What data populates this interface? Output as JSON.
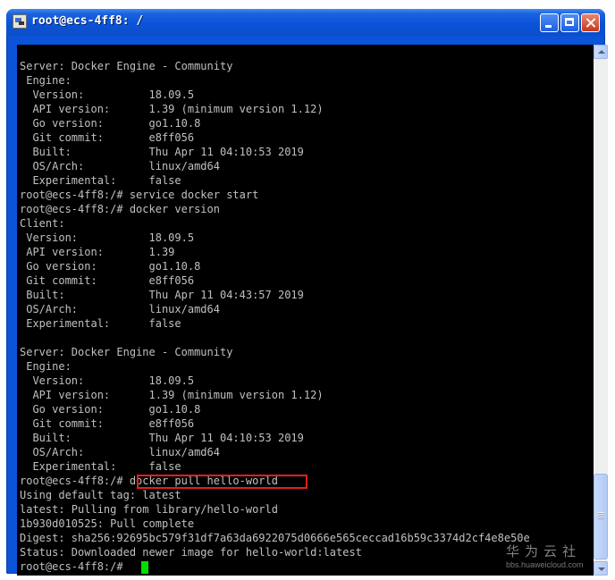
{
  "window": {
    "title": "root@ecs-4ff8: /"
  },
  "terminal": {
    "lines": [
      "",
      "Server: Docker Engine - Community",
      " Engine:",
      "  Version:          18.09.5",
      "  API version:      1.39 (minimum version 1.12)",
      "  Go version:       go1.10.8",
      "  Git commit:       e8ff056",
      "  Built:            Thu Apr 11 04:10:53 2019",
      "  OS/Arch:          linux/amd64",
      "  Experimental:     false",
      "root@ecs-4ff8:/# service docker start",
      "root@ecs-4ff8:/# docker version",
      "Client:",
      " Version:           18.09.5",
      " API version:       1.39",
      " Go version:        go1.10.8",
      " Git commit:        e8ff056",
      " Built:             Thu Apr 11 04:43:57 2019",
      " OS/Arch:           linux/amd64",
      " Experimental:      false",
      "",
      "Server: Docker Engine - Community",
      " Engine:",
      "  Version:          18.09.5",
      "  API version:      1.39 (minimum version 1.12)",
      "  Go version:       go1.10.8",
      "  Git commit:       e8ff056",
      "  Built:            Thu Apr 11 04:10:53 2019",
      "  OS/Arch:          linux/amd64",
      "  Experimental:     false",
      "root@ecs-4ff8:/# docker pull hello-world",
      "Using default tag: latest",
      "latest: Pulling from library/hello-world",
      "1b930d010525: Pull complete",
      "Digest: sha256:92695bc579f31df7a63da6922075d0666e565ceccad16b59c3374d2cf4e8e50e",
      "Status: Downloaded newer image for hello-world:latest",
      "root@ecs-4ff8:/# "
    ],
    "highlighted_command": "docker pull hello-world",
    "cursor_color": "#00e000",
    "highlight_color": "#e0201c"
  },
  "watermark": {
    "brand": "华为云社",
    "url": "bbs.huaweicloud.com"
  }
}
